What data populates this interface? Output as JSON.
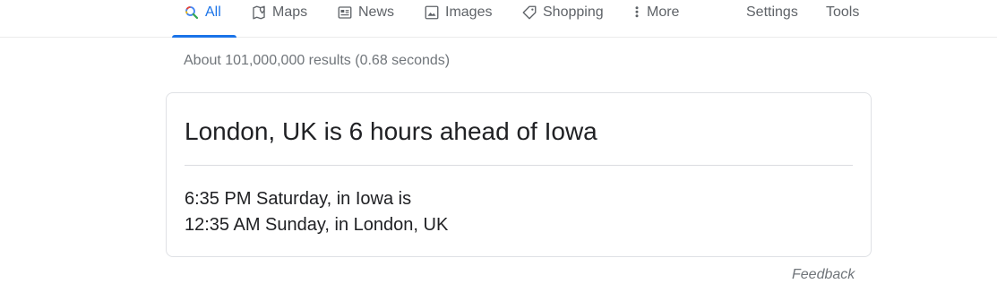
{
  "tabs": [
    {
      "label": "All",
      "icon": "search-icon",
      "active": true
    },
    {
      "label": "Maps",
      "icon": "map-icon",
      "active": false
    },
    {
      "label": "News",
      "icon": "news-icon",
      "active": false
    },
    {
      "label": "Images",
      "icon": "image-icon",
      "active": false
    },
    {
      "label": "Shopping",
      "icon": "tag-icon",
      "active": false
    },
    {
      "label": "More",
      "icon": "more-vertical-icon",
      "active": false
    }
  ],
  "tools": {
    "settings_label": "Settings",
    "tools_label": "Tools"
  },
  "result_stats": "About 101,000,000 results (0.68 seconds)",
  "time_card": {
    "title": "London, UK is 6 hours ahead of Iowa",
    "line1": "6:35 PM Saturday, in Iowa is",
    "line2": "12:35 AM Sunday, in London, UK"
  },
  "feedback_label": "Feedback",
  "colors": {
    "accent": "#1a73e8",
    "tab_text": "#5f6368",
    "meta_text": "#70757a",
    "body_text": "#202124",
    "border": "#dfe1e5"
  }
}
